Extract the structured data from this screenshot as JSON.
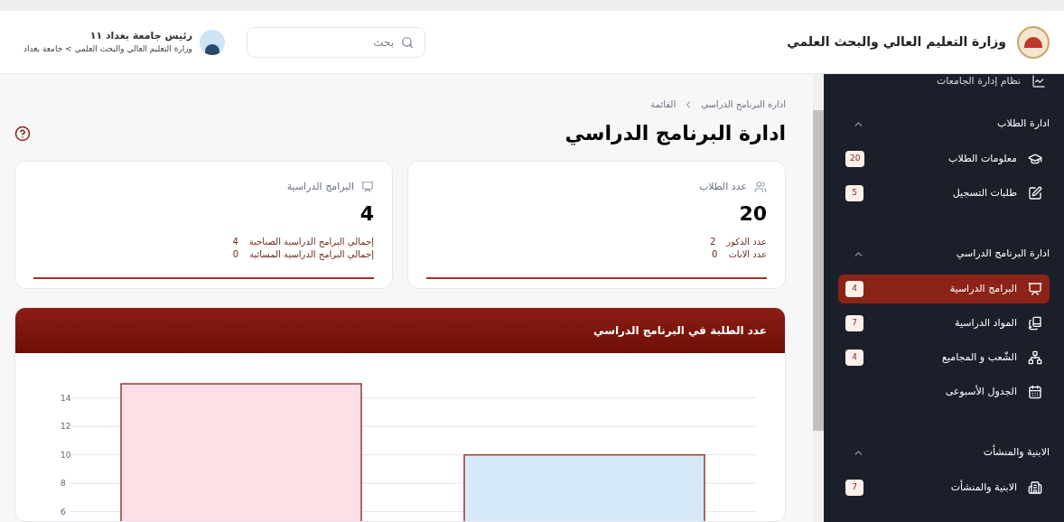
{
  "header": {
    "title": "وزارة التعليم العالي والبحث العلمي",
    "search": {
      "placeholder": "بحث"
    },
    "user": {
      "name": "رئيس جامعة بغداد ١١",
      "path": "وزارة التعليم العالي والبحث العلمي > جامعة بغداد"
    }
  },
  "sidebar": {
    "top_item": "نظام إدارة الجامعات",
    "groups": [
      {
        "title": "ادارة الطلاب",
        "expanded": true,
        "items": [
          {
            "label": "معلومات الطلاب",
            "badge": "20",
            "kind": "students",
            "selected": false
          },
          {
            "label": "طلبات التسجيل",
            "badge": "5",
            "kind": "edit",
            "selected": false
          }
        ]
      },
      {
        "title": "ادارة البرنامج الدراسي",
        "expanded": true,
        "items": [
          {
            "label": "البرامج الدراسية",
            "badge": "4",
            "kind": "programs",
            "selected": true
          },
          {
            "label": "المواد الدراسية",
            "badge": "7",
            "kind": "books",
            "selected": false
          },
          {
            "label": "الشّعب و المجاميع",
            "badge": "4",
            "kind": "network",
            "selected": false
          },
          {
            "label": "الجدول الأسبوعى",
            "kind": "calendar",
            "selected": false
          }
        ]
      },
      {
        "title": "الابنية والمنشأت",
        "expanded": true,
        "items": [
          {
            "label": "الابنية والمنشأت",
            "badge": "7",
            "kind": "building",
            "selected": false
          }
        ]
      }
    ]
  },
  "breadcrumb": [
    "ادارة البرنامج الدراسي",
    "القائمة"
  ],
  "page_title": "ادارة البرنامج الدراسي",
  "cards": [
    {
      "kind": "students",
      "label": "عدد الطلاب",
      "value": "20",
      "details": [
        {
          "label": "عدد الذكور",
          "value": "2"
        },
        {
          "label": "عدد الاناث",
          "value": "0"
        }
      ]
    },
    {
      "kind": "programs",
      "label": "البرامج الدراسية",
      "value": "4",
      "details": [
        {
          "label": "إجمالي البرامج الدراسية الصباحية",
          "value": "4"
        },
        {
          "label": "إجمالي البرامج الدراسية المسائية",
          "value": "0"
        }
      ]
    }
  ],
  "chart_panel": {
    "title": "عدد الطلبة في البرنامج الدراسي",
    "chart_data": {
      "type": "bar",
      "series": [
        {
          "color": "#fde0e6",
          "values": [
            15,
            null
          ]
        },
        {
          "color": "#d6e9f8",
          "values": [
            null,
            10
          ]
        }
      ],
      "ylim": [
        0,
        15
      ],
      "yticks": [
        6,
        8,
        10,
        12,
        14
      ],
      "grid": true
    }
  }
}
